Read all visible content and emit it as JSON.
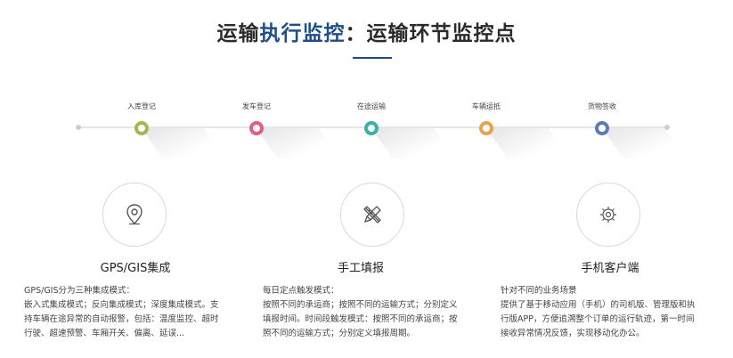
{
  "header": {
    "title_part1": "运输",
    "title_highlight": "执行监控",
    "title_part2": "：运输环节监控点"
  },
  "timeline": {
    "steps": [
      {
        "label": "入库登记",
        "color": "#9fba4f"
      },
      {
        "label": "发车登记",
        "color": "#e2607e"
      },
      {
        "label": "在途运输",
        "color": "#3bb0a7"
      },
      {
        "label": "车辆运抵",
        "color": "#e8a24a"
      },
      {
        "label": "货物签收",
        "color": "#5b7ab8"
      }
    ]
  },
  "features": [
    {
      "icon": "location-pin-icon",
      "title": "GPS/GIS集成",
      "lines": [
        "GPS/GIS分为三种集成模式：",
        "嵌入式集成模式；反向集成模式；深度集成模式。支",
        "持车辆在途异常的自动报警，包括：温度监控、超时",
        "行驶、超速预警、车厢开关、偏离、延误..."
      ]
    },
    {
      "icon": "pencil-ruler-icon",
      "title": "手工填报",
      "lines": [
        "每日定点触发模式：",
        "按照不同的承运商；按照不同的运输方式；分别定义",
        "填报时间。时间段触发模式：按照不同的承运商；按",
        "照不同的运输方式；分别定义填报周期。"
      ]
    },
    {
      "icon": "mobile-gear-icon",
      "title": "手机客户端",
      "lines": [
        "针对不同的业务场景",
        "提供了基于移动应用（手机）的司机版、管理版和执",
        "行版APP，方便追溯整个订单的运行轨迹，第一时间",
        "接收异常情况反馈，实现移动化办公。"
      ]
    }
  ]
}
